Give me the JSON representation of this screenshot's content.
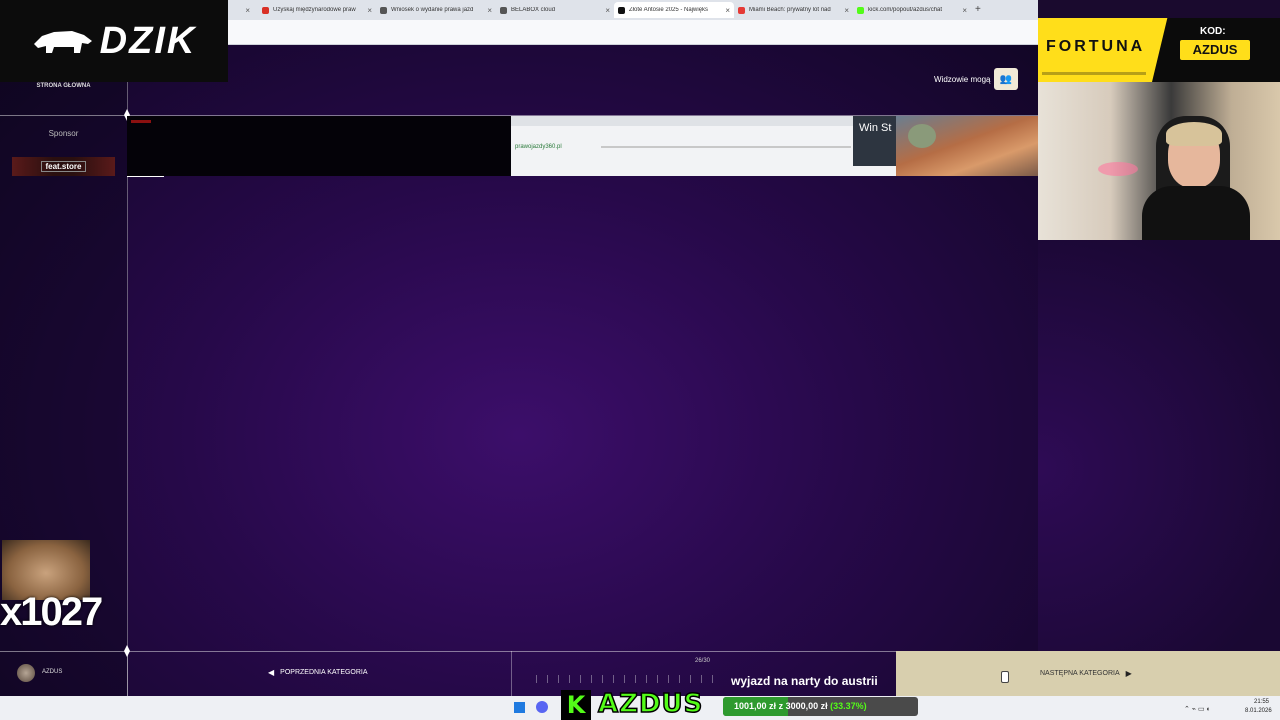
{
  "browser": {
    "tabs": [
      {
        "label": "",
        "favicon_color": "#888888",
        "active": false
      },
      {
        "label": "Uzyskaj międzynarodowe praw",
        "favicon_color": "#d93025",
        "active": false
      },
      {
        "label": "Wniosek o wydanie prawa jazd",
        "favicon_color": "#555555",
        "active": false
      },
      {
        "label": "BELABOX cloud",
        "favicon_color": "#555555",
        "active": false
      },
      {
        "label": "Złote Antosie 2025 - Najwięks",
        "favicon_color": "#111111",
        "active": true
      },
      {
        "label": "Miami Beach: prywatny lot nad",
        "favicon_color": "#e53935",
        "active": false
      },
      {
        "label": "kick.com/popout/azdus/chat",
        "favicon_color": "#53fc18",
        "active": false
      }
    ],
    "new_tab": "+",
    "window_controls": [
      "–",
      "▫",
      "✕"
    ]
  },
  "overlay": {
    "logo_text": "DZIK",
    "fortuna": {
      "brand": "FORTUNA",
      "kod_label": "KOD:",
      "code": "AZDUS"
    },
    "count_text": "x1027"
  },
  "page": {
    "home_link": "STRONA GŁÓWNA",
    "sponsor_label": "Sponsor",
    "sponsor_name": "feat.store",
    "viewers_label": "Widzowie mogą",
    "user_name": "AZDUS",
    "prev_category": "POPRZEDNIA KATEGORIA",
    "next_category": "NASTĘPNA KATEGORIA",
    "progress_counter": "26/30",
    "thumb_win_text": "Win St",
    "thumb_site_text": "prawojazdy360.pl"
  },
  "stream_overlay": {
    "ticker": "wyjazd na narty do austrii",
    "kick_letter": "K",
    "channel": "AZDUS",
    "goal_current": "1001,00 zł",
    "goal_separator": "z",
    "goal_target": "3000,00 zł",
    "goal_percent": "(33.37%)",
    "goal_fraction": 0.3337
  },
  "taskbar": {
    "time": "21:55",
    "date": "8.01.2026"
  },
  "colors": {
    "accent_green": "#53fc18",
    "fortuna_yellow": "#ffde1a",
    "stage_purple": "#3c0e6a"
  }
}
